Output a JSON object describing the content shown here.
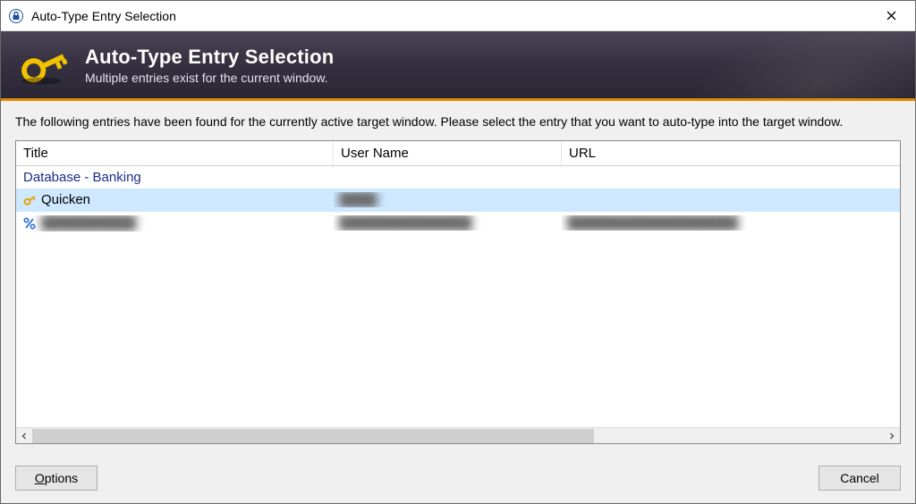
{
  "window": {
    "title": "Auto-Type Entry Selection"
  },
  "header": {
    "title": "Auto-Type Entry Selection",
    "subtitle": "Multiple entries exist for the current window."
  },
  "instruction": "The following entries have been found for the currently active target window. Please select the entry that you want to auto-type into the target window.",
  "columns": {
    "title": "Title",
    "user": "User Name",
    "url": "URL"
  },
  "group_header": "Database - Banking",
  "entries": [
    {
      "title": "Quicken",
      "user": "████",
      "url": "",
      "icon": "key",
      "selected": true,
      "redacted": true
    },
    {
      "title": "██████████",
      "user": "██████████████",
      "url": "██████████████████",
      "icon": "percent",
      "selected": false,
      "redacted": true
    }
  ],
  "buttons": {
    "options": "Options",
    "cancel": "Cancel"
  }
}
